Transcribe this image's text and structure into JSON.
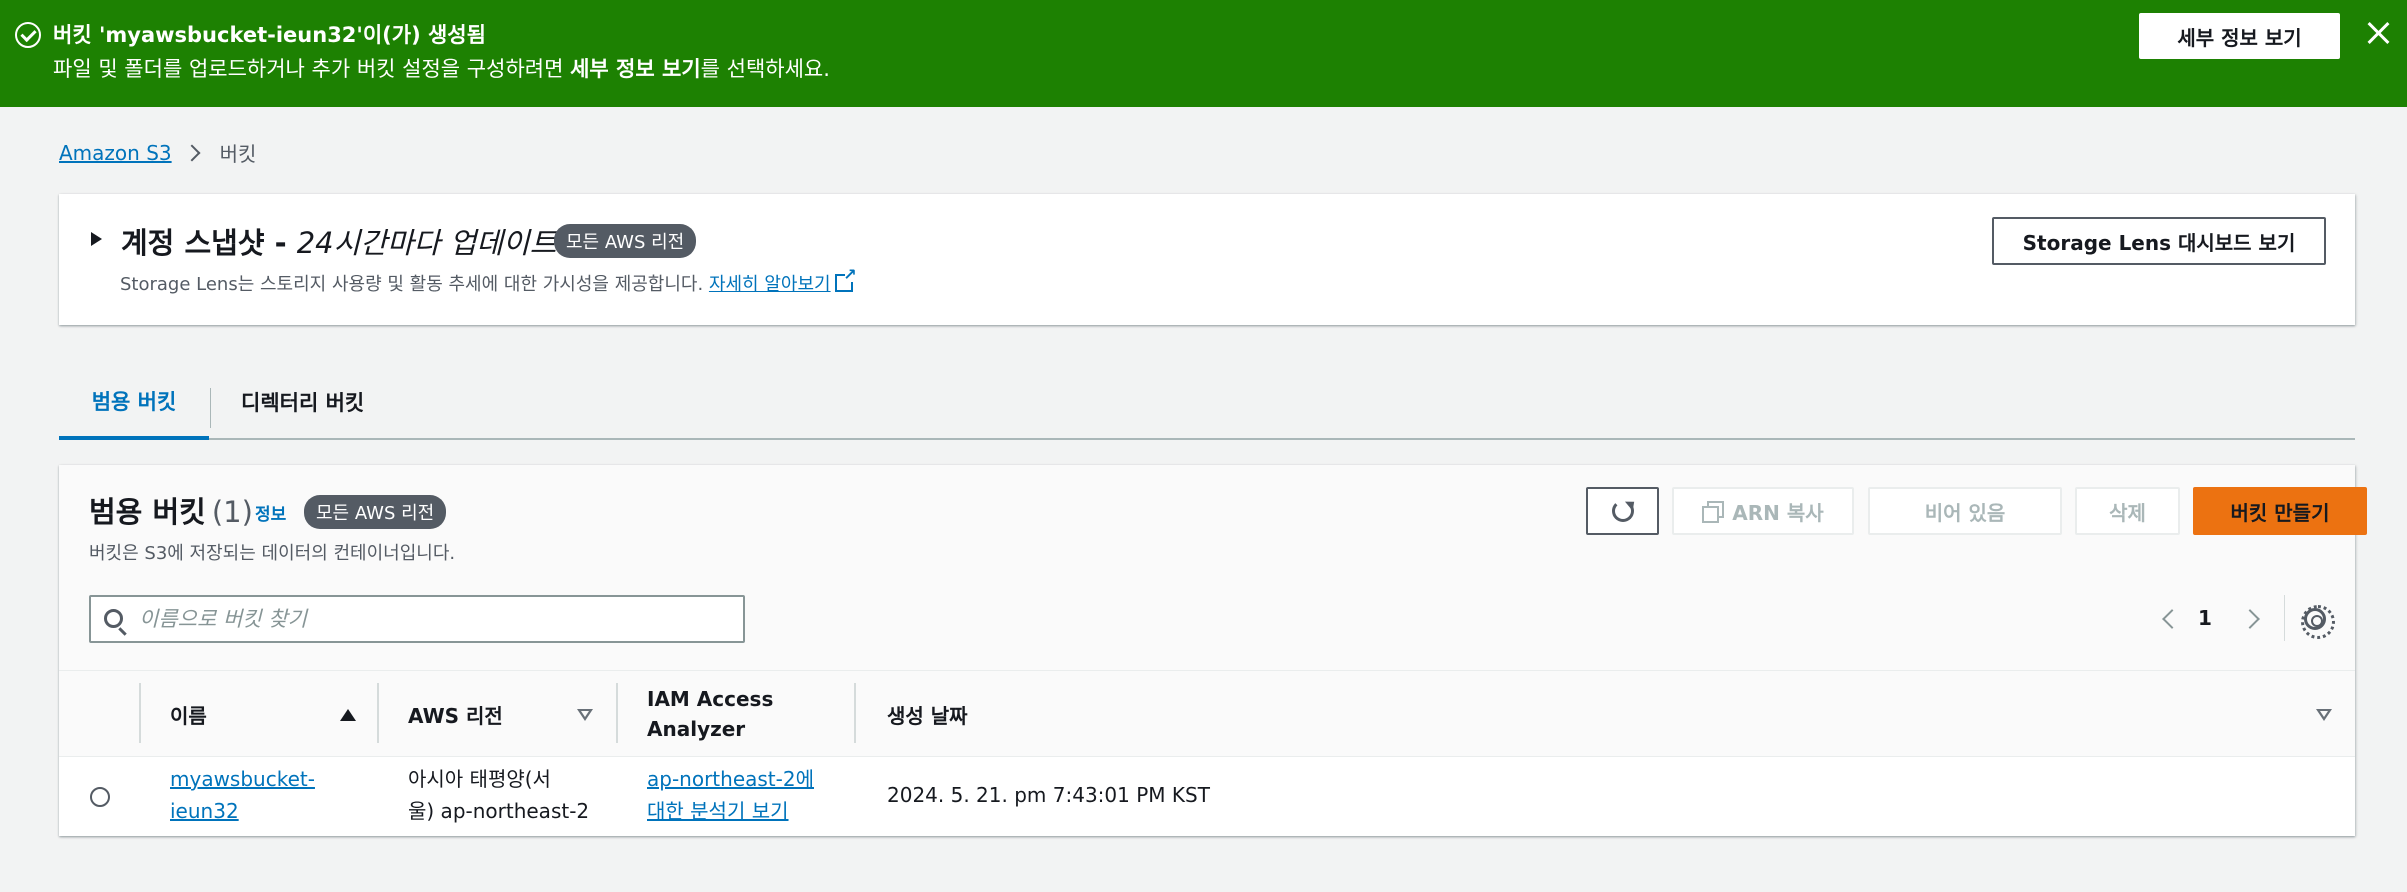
{
  "flash": {
    "title": "버킷 'myawsbucket-ieun32'이(가) 생성됨",
    "message_prefix": "파일 및 폴더를 업로드하거나 추가 버킷 설정을 구성하려면 ",
    "message_bold": "세부 정보 보기",
    "message_suffix": "를 선택하세요.",
    "button_label": "세부 정보 보기"
  },
  "breadcrumb": {
    "root": "Amazon S3",
    "current": "버킷"
  },
  "snapshot": {
    "title": "계정 스냅샷 - ",
    "subtitle": "24시간마다 업데이트",
    "badge": "모든 AWS 리전",
    "desc": "Storage Lens는 스토리지 사용량 및 활동 추세에 대한 가시성을 제공합니다. ",
    "learn_more": "자세히 알아보기",
    "lens_button": "Storage Lens 대시보드 보기"
  },
  "tabs": [
    {
      "label": "범용 버킷",
      "active": true
    },
    {
      "label": "디렉터리 버킷",
      "active": false
    }
  ],
  "buckets": {
    "title": "범용 버킷",
    "count": "(1)",
    "info": "정보",
    "badge": "모든 AWS 리전",
    "desc": "버킷은 S3에 저장되는 데이터의 컨테이너입니다.",
    "buttons": {
      "copy_arn": "ARN 복사",
      "empty": "비어 있음",
      "delete": "삭제",
      "create": "버킷 만들기"
    },
    "search_placeholder": "이름으로 버킷 찾기",
    "page": "1",
    "columns": {
      "name": "이름",
      "region": "AWS 리전",
      "iam_line1": "IAM Access",
      "iam_line2": "Analyzer",
      "created": "생성 날짜"
    },
    "rows": [
      {
        "name_line1": "myawsbucket-",
        "name_line2": "ieun32",
        "region_line1": "아시아 태평양(서",
        "region_line2": "울) ap-northeast-2",
        "iam_line1": "ap-northeast-2에",
        "iam_line2": "대한 분석기 보기",
        "created": "2024. 5. 21. pm 7:43:01 PM KST"
      }
    ]
  },
  "colors": {
    "flash_green": "#1d8102",
    "link_blue": "#0073bb",
    "primary_orange": "#ec7211",
    "badge_gray": "#545b64"
  }
}
